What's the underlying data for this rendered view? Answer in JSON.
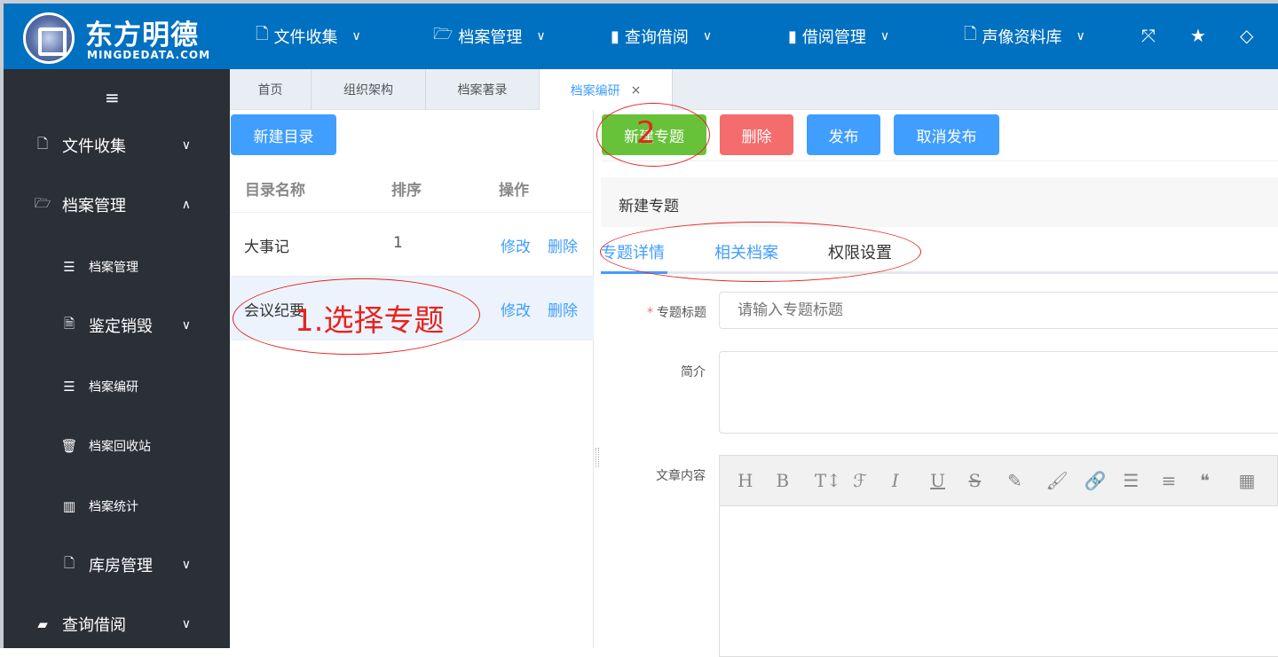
{
  "logo": {
    "name": "东方明德",
    "domain": "MINGDEDATA.COM"
  },
  "topnav": [
    {
      "label": "文件收集",
      "icon": "pdf-file-icon"
    },
    {
      "label": "档案管理",
      "icon": "folder-open-icon"
    },
    {
      "label": "查询借阅",
      "icon": "book-icon"
    },
    {
      "label": "借阅管理",
      "icon": "bookmark-icon"
    },
    {
      "label": "声像资料库",
      "icon": "video-file-icon"
    }
  ],
  "header_icons": [
    "fullscreen-icon",
    "star-icon",
    "diamond-icon"
  ],
  "sidebar": {
    "menu_icon": "hamburger-icon",
    "items": [
      {
        "label": "文件收集",
        "icon": "pdf-file-icon",
        "expanded": false
      },
      {
        "label": "档案管理",
        "icon": "folder-open-icon",
        "expanded": true
      },
      {
        "label": "档案管理",
        "icon": "list-icon",
        "sub": true
      },
      {
        "label": "鉴定销毁",
        "icon": "document-icon",
        "sub": true,
        "expanded": false
      },
      {
        "label": "档案编研",
        "icon": "list-icon",
        "sub": true
      },
      {
        "label": "档案回收站",
        "icon": "trash-icon",
        "sub": true
      },
      {
        "label": "档案统计",
        "icon": "bar-chart-icon",
        "sub": true
      },
      {
        "label": "库房管理",
        "icon": "file-icon",
        "sub": true,
        "expanded": false
      },
      {
        "label": "查询借阅",
        "icon": "book-icon",
        "expanded": false
      }
    ]
  },
  "tabs": [
    {
      "label": "首页"
    },
    {
      "label": "组织架构"
    },
    {
      "label": "档案著录"
    },
    {
      "label": "档案编研",
      "active": true,
      "close": "×"
    }
  ],
  "left": {
    "new_catalog": "新建目录",
    "columns": [
      "目录名称",
      "排序",
      "操作"
    ],
    "rows": [
      {
        "name": "大事记",
        "order": "1",
        "edit": "修改",
        "delete": "删除"
      },
      {
        "name": "会议纪要",
        "order": "",
        "edit": "修改",
        "delete": "删除",
        "selected": true
      }
    ]
  },
  "right": {
    "buttons": {
      "new_topic": "新建专题",
      "delete": "删除",
      "publish": "发布",
      "unpublish": "取消发布"
    },
    "dialog_title": "新建专题",
    "subtabs": [
      {
        "label": "专题详情",
        "active": true
      },
      {
        "label": "相关档案"
      },
      {
        "label": "权限设置"
      }
    ],
    "form": {
      "title_label": "专题标题",
      "required": "*",
      "title_placeholder": "请输入专题标题",
      "intro_label": "简介",
      "content_label": "文章内容"
    },
    "editor_toolbar": [
      "H",
      "B",
      "T↕",
      "ℱ",
      "I",
      "U",
      "S",
      "✎",
      "🖌",
      "🔗",
      "☰",
      "≡",
      "❝",
      "▦"
    ]
  },
  "annotations": {
    "step1": "1.选择专题",
    "step2": "2"
  },
  "colors": {
    "header": "#0070c0",
    "sidebar": "#2b2f36",
    "primary": "#409eff",
    "success": "#67c23a",
    "danger": "#f56c6c",
    "annotation": "#e8231e"
  }
}
